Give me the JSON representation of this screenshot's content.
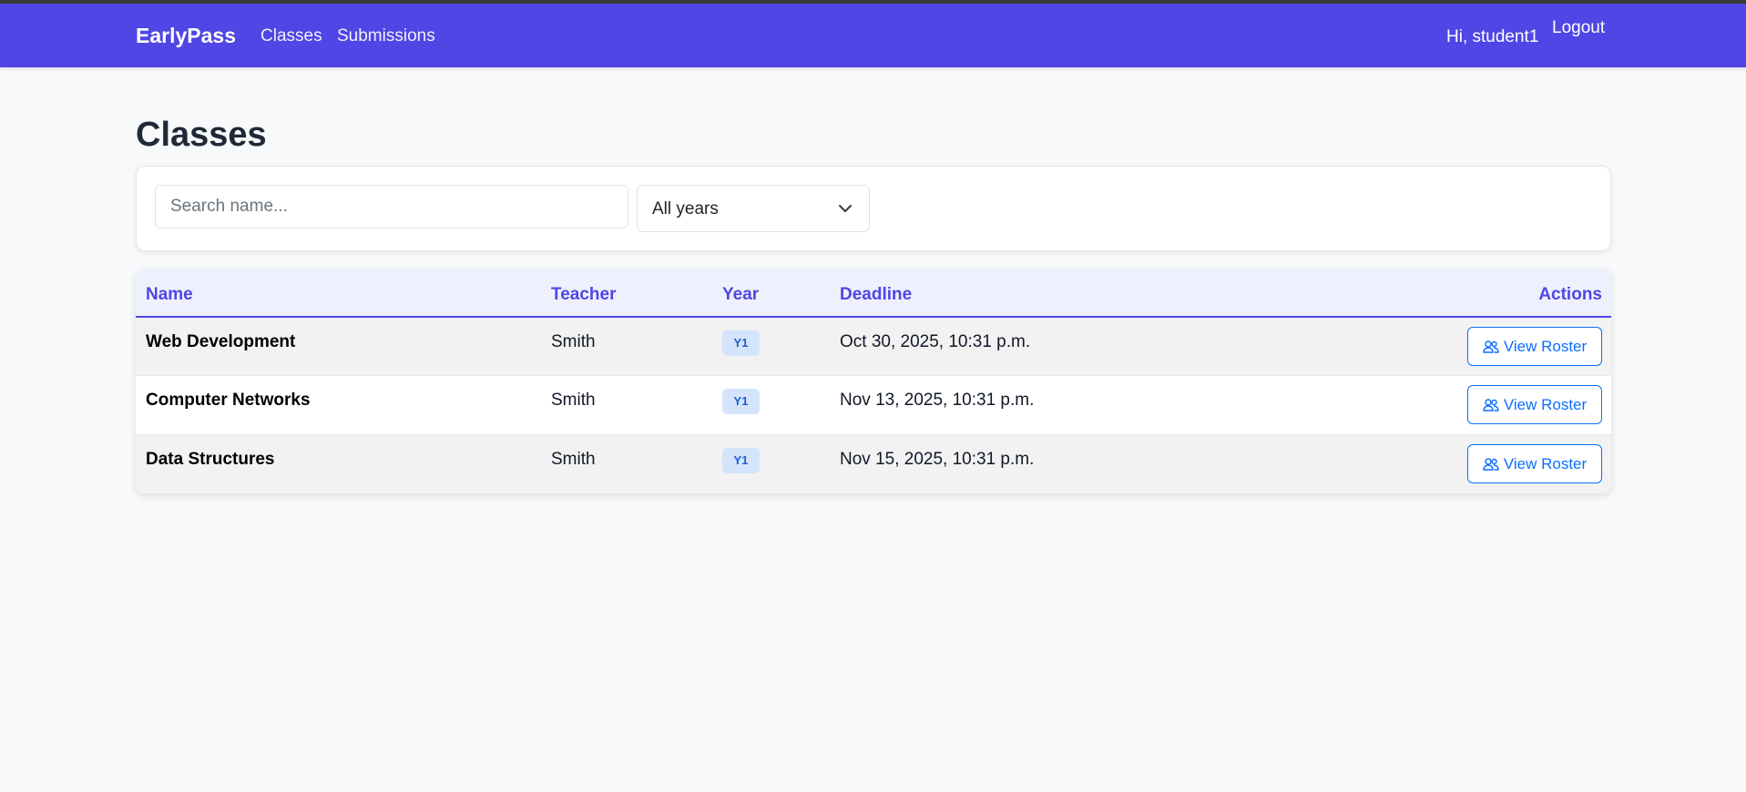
{
  "navbar": {
    "brand": "EarlyPass",
    "links": [
      "Classes",
      "Submissions"
    ],
    "greeting": "Hi, student1",
    "logout": "Logout",
    "color": "#4f46e5"
  },
  "page": {
    "title": "Classes"
  },
  "filters": {
    "search_placeholder": "Search name...",
    "search_value": "",
    "year_selected": "All years"
  },
  "table": {
    "headers": {
      "name": "Name",
      "teacher": "Teacher",
      "year": "Year",
      "deadline": "Deadline",
      "actions": "Actions"
    },
    "rows": [
      {
        "name": "Web Development",
        "teacher": "Smith",
        "year": "Y1",
        "deadline": "Oct 30, 2025, 10:31 p.m.",
        "action": "View Roster"
      },
      {
        "name": "Computer Networks",
        "teacher": "Smith",
        "year": "Y1",
        "deadline": "Nov 13, 2025, 10:31 p.m.",
        "action": "View Roster"
      },
      {
        "name": "Data Structures",
        "teacher": "Smith",
        "year": "Y1",
        "deadline": "Nov 15, 2025, 10:31 p.m.",
        "action": "View Roster"
      }
    ]
  },
  "icons": {
    "roster": "people-icon",
    "select": "chevron-down-icon"
  }
}
